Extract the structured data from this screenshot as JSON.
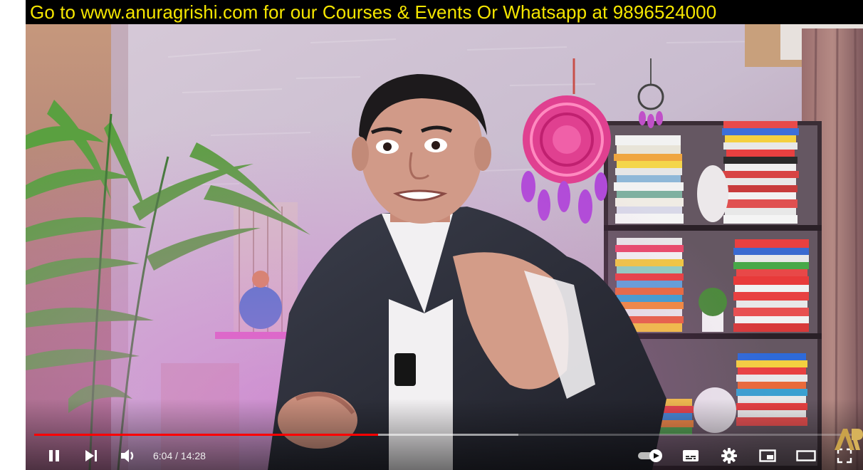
{
  "banner": {
    "text": "Go to www.anuragrishi.com for our Courses & Events Or Whatsapp at 9896524000"
  },
  "player": {
    "time": {
      "current": "6:04",
      "separator": " / ",
      "duration": "14:28"
    },
    "progress": {
      "played_fraction": 0.419,
      "loaded_fraction": 0.59
    },
    "autoplay_enabled": true,
    "controls": {
      "play_pause": "pause-icon",
      "next": "next-icon",
      "volume": "volume-icon",
      "autoplay": "autoplay-toggle",
      "subtitles": "subtitles-icon",
      "settings": "gear-icon",
      "miniplayer": "miniplayer-icon",
      "theater": "theater-mode-icon",
      "fullscreen": "fullscreen-icon"
    },
    "watermark": "AR"
  },
  "colors": {
    "banner_text": "#f5e600",
    "banner_bg": "#000000",
    "progress_played": "#ff0000",
    "scene_wall": "#c9b8cf"
  }
}
